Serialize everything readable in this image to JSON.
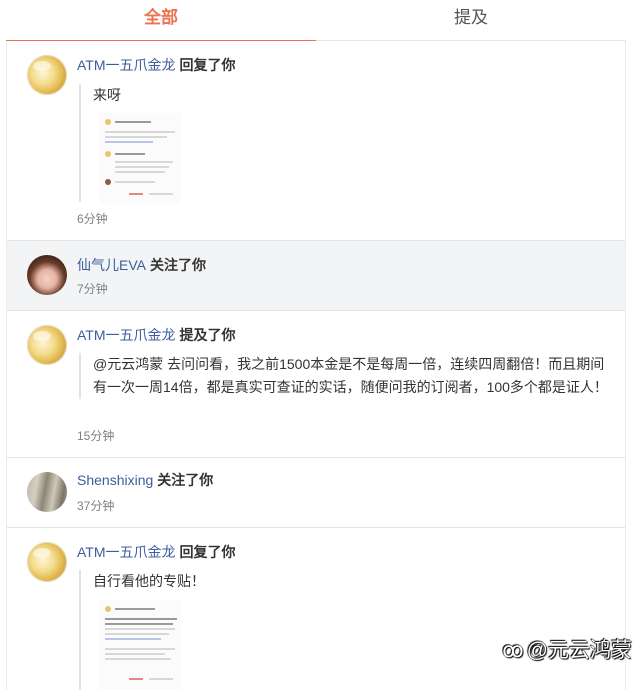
{
  "tabs": [
    {
      "label": "全部",
      "active": true
    },
    {
      "label": "提及",
      "active": false
    }
  ],
  "notifications": [
    {
      "user": "ATM一五爪金龙",
      "action": "回复了你",
      "text": "来呀",
      "time": "6分钟",
      "avatar": "gold-coin-avatar",
      "has_image": true
    },
    {
      "user": "仙气儿EVA",
      "action": "关注了你",
      "time": "7分钟",
      "avatar": "woman-portrait-avatar"
    },
    {
      "user": "ATM一五爪金龙",
      "action": "提及了你",
      "text": "@元云鸿蒙 去问问看，我之前1500本金是不是每周一倍，连续四周翻倍！而且期间有一次一周14倍，都是真实可查证的实话，随便问我的订阅者，100多个都是证人！",
      "time": "15分钟",
      "avatar": "gold-coin-avatar"
    },
    {
      "user": "Shenshixing",
      "action": "关注了你",
      "time": "37分钟",
      "avatar": "stone-wall-avatar"
    },
    {
      "user": "ATM一五爪金龙",
      "action": "回复了你",
      "text": "自行看他的专贴！",
      "avatar": "gold-coin-avatar",
      "has_image": true
    }
  ],
  "watermark": {
    "icon": "weibo-logo-icon",
    "text": "@元云鸿蒙"
  },
  "colors": {
    "accent": "#eb7350",
    "username": "#3c5d9e",
    "highlight_bg": "#f3f4f6"
  }
}
